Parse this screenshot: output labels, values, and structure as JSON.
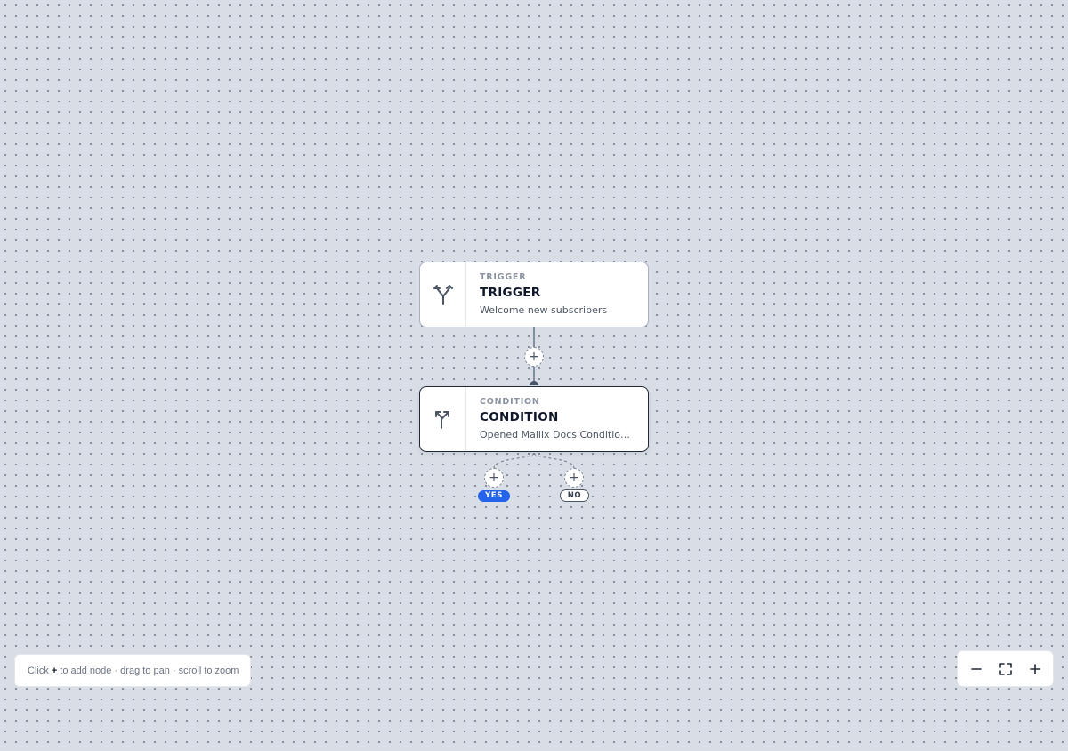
{
  "nodes": {
    "trigger": {
      "kicker": "TRIGGER",
      "title": "TRIGGER",
      "description": "Welcome new subscribers",
      "icon": "split-arrows-icon"
    },
    "condition": {
      "kicker": "CONDITION",
      "title": "CONDITION",
      "description": "Opened Mailix Docs Condition...",
      "icon": "branch-arrows-icon"
    }
  },
  "add_button_symbol": "+",
  "branches": {
    "yes_label": "YES",
    "no_label": "NO"
  },
  "hint": {
    "prefix": "Click",
    "key": "+",
    "suffix": "to add node · drag to pan · scroll to zoom"
  },
  "zoom_controls": {
    "zoom_out_icon": "minus-icon",
    "fit_icon": "fit-view-icon",
    "zoom_in_icon": "plus-icon"
  },
  "colors": {
    "canvas_bg": "#d9dee6",
    "edge": "#64748b",
    "yes_badge": "#2563eb",
    "node_border_selected": "#1f2937"
  }
}
